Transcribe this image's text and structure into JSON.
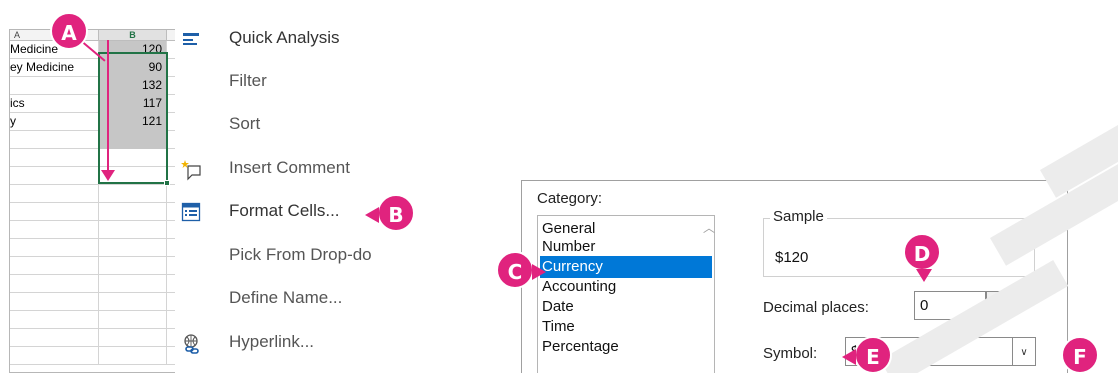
{
  "spreadsheet": {
    "col_a": "A",
    "col_b": "B",
    "rows": [
      {
        "a": "Medicine",
        "b": "120"
      },
      {
        "a": "ey Medicine",
        "b": "90"
      },
      {
        "a": "",
        "b": "132"
      },
      {
        "a": "ics",
        "b": "117"
      },
      {
        "a": "y",
        "b": "121"
      },
      {
        "a": "",
        "b": ""
      },
      {
        "a": "",
        "b": ""
      },
      {
        "a": "",
        "b": ""
      },
      {
        "a": "",
        "b": ""
      },
      {
        "a": "",
        "b": ""
      },
      {
        "a": "",
        "b": ""
      },
      {
        "a": "",
        "b": ""
      },
      {
        "a": "",
        "b": ""
      },
      {
        "a": "",
        "b": ""
      },
      {
        "a": "",
        "b": ""
      },
      {
        "a": "",
        "b": ""
      },
      {
        "a": "",
        "b": ""
      },
      {
        "a": "",
        "b": ""
      }
    ]
  },
  "context_menu": {
    "items": [
      {
        "label": "Quick Analysis",
        "icon": "quick-analysis-icon"
      },
      {
        "label": "Filter",
        "icon": ""
      },
      {
        "label": "Sort",
        "icon": ""
      },
      {
        "label": "Insert Comment",
        "icon": "insert-comment-icon"
      },
      {
        "label": "Format Cells...",
        "icon": "format-cells-icon"
      },
      {
        "label": "Pick From Drop-do",
        "icon": ""
      },
      {
        "label": "Define Name...",
        "icon": ""
      },
      {
        "label": "Hyperlink...",
        "icon": "hyperlink-icon"
      }
    ]
  },
  "dialog": {
    "category_label": "Category:",
    "categories": [
      "General",
      "Number",
      "Currency",
      "Accounting",
      "Date",
      "Time",
      "Percentage"
    ],
    "selected_category": "Currency",
    "sample_label": "Sample",
    "sample_value": "$120",
    "decimal_label": "Decimal places:",
    "decimal_value": "0",
    "symbol_label": "Symbol:",
    "symbol_value": "$"
  },
  "callouts": {
    "a": "A",
    "b": "B",
    "c": "C",
    "d": "D",
    "e": "E",
    "f": "F"
  },
  "colors": {
    "callout": "#e0237e",
    "selection": "#217346",
    "highlight": "#0078d7"
  }
}
